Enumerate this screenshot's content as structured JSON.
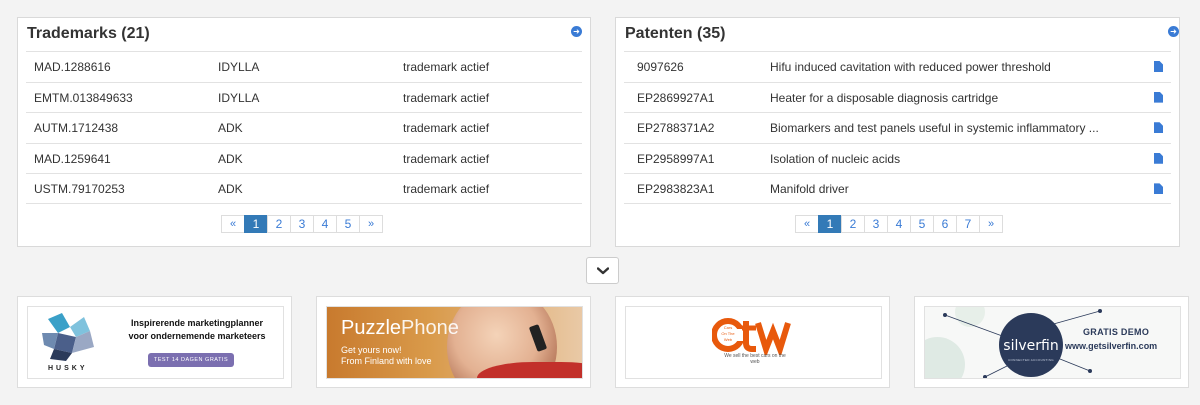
{
  "trademarks": {
    "title": "Trademarks (21)",
    "rows": [
      {
        "number": "MAD.1288616",
        "name": "IDYLLA",
        "status": "trademark actief"
      },
      {
        "number": "EMTM.013849633",
        "name": "IDYLLA",
        "status": "trademark actief"
      },
      {
        "number": "AUTM.1712438",
        "name": "ADK",
        "status": "trademark actief"
      },
      {
        "number": "MAD.1259641",
        "name": "ADK",
        "status": "trademark actief"
      },
      {
        "number": "USTM.79170253",
        "name": "ADK",
        "status": "trademark actief"
      }
    ],
    "pager": {
      "prev": "«",
      "next": "»",
      "pages": [
        "1",
        "2",
        "3",
        "4",
        "5"
      ],
      "current": "1"
    }
  },
  "patents": {
    "title": "Patenten (35)",
    "rows": [
      {
        "number": "9097626",
        "title": "Hifu induced cavitation with reduced power threshold"
      },
      {
        "number": "EP2869927A1",
        "title": "Heater for a disposable diagnosis cartridge"
      },
      {
        "number": "EP2788371A2",
        "title": "Biomarkers and test panels useful in systemic inflammatory ..."
      },
      {
        "number": "EP2958997A1",
        "title": "Isolation of nucleic acids"
      },
      {
        "number": "EP2983823A1",
        "title": "Manifold driver"
      }
    ],
    "pager": {
      "prev": "«",
      "next": "»",
      "pages": [
        "1",
        "2",
        "3",
        "4",
        "5",
        "6",
        "7"
      ],
      "current": "1"
    }
  },
  "icons": {
    "panel_link": "arrow-circle-right-icon",
    "document": "document-icon",
    "expand": "chevron-down-icon"
  },
  "ads": {
    "husky": {
      "brand": "HUSKY",
      "headline_line1": "Inspirerende marketingplanner",
      "headline_line2": "voor ondernemende marketeers",
      "cta": "TEST 14 DAGEN GRATIS"
    },
    "puzzlephone": {
      "title_a": "Puzzle",
      "title_b": "Phone",
      "sub_line1": "Get yours now!",
      "sub_line2": "From Finland with love"
    },
    "cotw": {
      "small_lines": [
        "Cars",
        "On The",
        "Web"
      ],
      "tag": "We sell the best cars on the web"
    },
    "silverfin": {
      "logo": "silverfin",
      "logo_sub": "CONNECTED ACCOUNTING",
      "demo": "GRATIS DEMO",
      "url": "www.getsilverfin.com"
    }
  },
  "colors": {
    "accent": "#3a7bd5",
    "active_page": "#337ab7",
    "cotw_orange": "#e8590c",
    "silverfin_navy": "#2b3a5a"
  }
}
